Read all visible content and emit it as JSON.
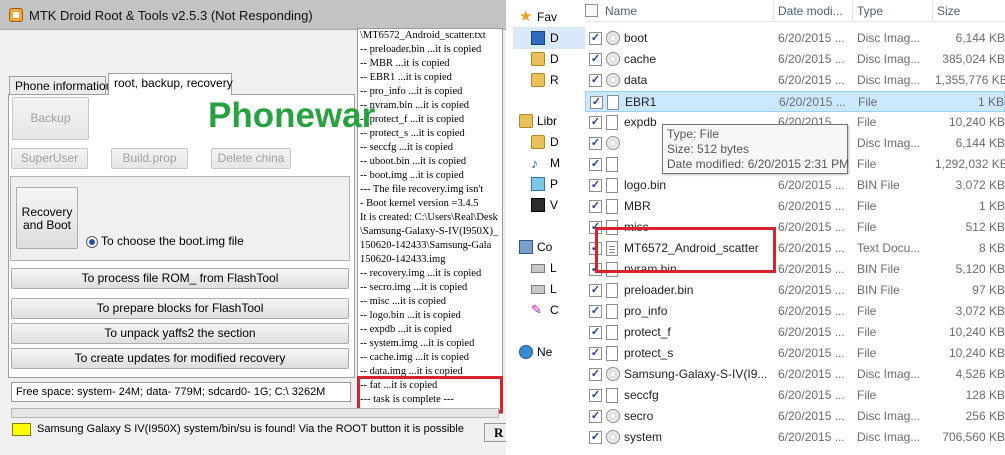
{
  "mtk": {
    "title": "MTK Droid Root & Tools v2.5.3 (Not Responding)",
    "tabs": [
      {
        "label": "Phone information"
      },
      {
        "label": "root, backup, recovery"
      }
    ],
    "buttons": {
      "backup": "Backup",
      "superuser": "SuperUser",
      "buildprop": "Build.prop",
      "delete_china": "Delete china",
      "recovery_and_boot": "Recovery and Boot",
      "process_rom": "To process file ROM_ from FlashTool",
      "prepare_blocks": "To prepare blocks for FlashTool",
      "unpack_yaffs": "To unpack yaffs2 the section",
      "create_updates": "To create updates for modified recovery"
    },
    "radio_label": "To choose the boot.img file",
    "log_lines": [
      "\\MT6572_Android_scatter.txt",
      "  -- preloader.bin ...it is copied",
      "  -- MBR ...it is copied",
      "  -- EBR1 ...it is copied",
      "  -- pro_info ...it is copied",
      "  -- nvram.bin ...it is copied",
      "  -- protect_f ...it is copied",
      "  -- protect_s ...it is copied",
      "  -- seccfg ...it is copied",
      "  -- uboot.bin ...it is copied",
      "  -- boot.img ...it is copied",
      " --- The file recovery.img isn't",
      "  - Boot kernel version =3.4.5",
      "It is created: C:\\Users\\Real\\Desk",
      "\\Samsung-Galaxy-S-IV(I950X)_",
      "150620-142433\\Samsung-Gala",
      "150620-142433.img",
      "  -- recovery.img ...it is copied",
      "  -- secro.img ...it is copied",
      "  -- misc ...it is copied",
      "  -- logo.bin ...it is copied",
      "  -- expdb ...it is copied",
      "  -- system.img ...it is copied",
      "  -- cache.img ...it is copied",
      "  -- data.img ...it is copied",
      "  -- fat ...it is copied",
      "--- task is complete ---"
    ],
    "free_space": "Free space: system- 24M; data- 779M; sdcard0- 1G;  C:\\ 3262M",
    "status_text": "Samsung Galaxy S IV(I950X) system/bin/su is found! Via the ROOT button it is possible",
    "root_button": "R",
    "watermark": "Phonewar",
    "status_color": "#ffff00",
    "highlight_color": "#d7232b"
  },
  "explorer": {
    "nav": [
      {
        "label": "Fav",
        "icon": "star-icon"
      },
      {
        "label": "D",
        "icon": "desktop-icon"
      },
      {
        "label": "D",
        "icon": "downloads-icon"
      },
      {
        "label": "R",
        "icon": "recent-places-icon"
      },
      {
        "label": "Libr",
        "icon": "libraries-icon"
      },
      {
        "label": "D",
        "icon": "documents-icon"
      },
      {
        "label": "M",
        "icon": "music-icon"
      },
      {
        "label": "P",
        "icon": "pictures-icon"
      },
      {
        "label": "V",
        "icon": "videos-icon"
      },
      {
        "label": "Co",
        "icon": "computer-icon"
      },
      {
        "label": "L",
        "icon": "local-disk-icon"
      },
      {
        "label": "L",
        "icon": "local-disk-icon"
      },
      {
        "label": "C",
        "icon": "pin-icon"
      },
      {
        "label": "Ne",
        "icon": "network-icon"
      }
    ],
    "columns": {
      "name": "Name",
      "date": "Date modi...",
      "type": "Type",
      "size": "Size"
    },
    "files": [
      {
        "name": "boot",
        "date": "6/20/2015 ...",
        "type": "Disc Imag...",
        "size": "6,144 KB",
        "icon": "disc"
      },
      {
        "name": "cache",
        "date": "6/20/2015 ...",
        "type": "Disc Imag...",
        "size": "385,024 KB",
        "icon": "disc"
      },
      {
        "name": "data",
        "date": "6/20/2015 ...",
        "type": "Disc Imag...",
        "size": "1,355,776 KB",
        "icon": "disc"
      },
      {
        "name": "EBR1",
        "date": "6/20/2015 ...",
        "type": "File",
        "size": "1 KB",
        "icon": "file"
      },
      {
        "name": "expdb",
        "date": "6/20/2015 ...",
        "type": "File",
        "size": "10,240 KB",
        "icon": "file"
      },
      {
        "name": "",
        "date": "",
        "type": "Disc Imag...",
        "size": "6,144 KB",
        "icon": "disc"
      },
      {
        "name": "",
        "date": "",
        "type": "File",
        "size": "1,292,032 KB",
        "icon": "file"
      },
      {
        "name": "logo.bin",
        "date": "6/20/2015 ...",
        "type": "BIN File",
        "size": "3,072 KB",
        "icon": "file"
      },
      {
        "name": "MBR",
        "date": "6/20/2015 ...",
        "type": "File",
        "size": "1 KB",
        "icon": "file"
      },
      {
        "name": "misc",
        "date": "6/20/2015 ...",
        "type": "File",
        "size": "512 KB",
        "icon": "file"
      },
      {
        "name": "MT6572_Android_scatter",
        "date": "6/20/2015 ...",
        "type": "Text Docu...",
        "size": "8 KB",
        "icon": "text"
      },
      {
        "name": "nvram.bin",
        "date": "6/20/2015 ...",
        "type": "BIN File",
        "size": "5,120 KB",
        "icon": "file"
      },
      {
        "name": "preloader.bin",
        "date": "6/20/2015 ...",
        "type": "BIN File",
        "size": "97 KB",
        "icon": "file"
      },
      {
        "name": "pro_info",
        "date": "6/20/2015 ...",
        "type": "File",
        "size": "3,072 KB",
        "icon": "file"
      },
      {
        "name": "protect_f",
        "date": "6/20/2015 ...",
        "type": "File",
        "size": "10,240 KB",
        "icon": "file"
      },
      {
        "name": "protect_s",
        "date": "6/20/2015 ...",
        "type": "File",
        "size": "10,240 KB",
        "icon": "file"
      },
      {
        "name": "Samsung-Galaxy-S-IV(I9...",
        "date": "6/20/2015 ...",
        "type": "Disc Imag...",
        "size": "4,526 KB",
        "icon": "disc"
      },
      {
        "name": "seccfg",
        "date": "6/20/2015 ...",
        "type": "File",
        "size": "128 KB",
        "icon": "file"
      },
      {
        "name": "secro",
        "date": "6/20/2015 ...",
        "type": "Disc Imag...",
        "size": "256 KB",
        "icon": "disc"
      },
      {
        "name": "system",
        "date": "6/20/2015 ...",
        "type": "Disc Imag...",
        "size": "706,560 KB",
        "icon": "disc"
      }
    ],
    "tooltip": {
      "type": "Type: File",
      "size": "Size: 512 bytes",
      "modified": "Date modified: 6/20/2015 2:31 PM"
    },
    "selection_color": "#cce8ff"
  }
}
